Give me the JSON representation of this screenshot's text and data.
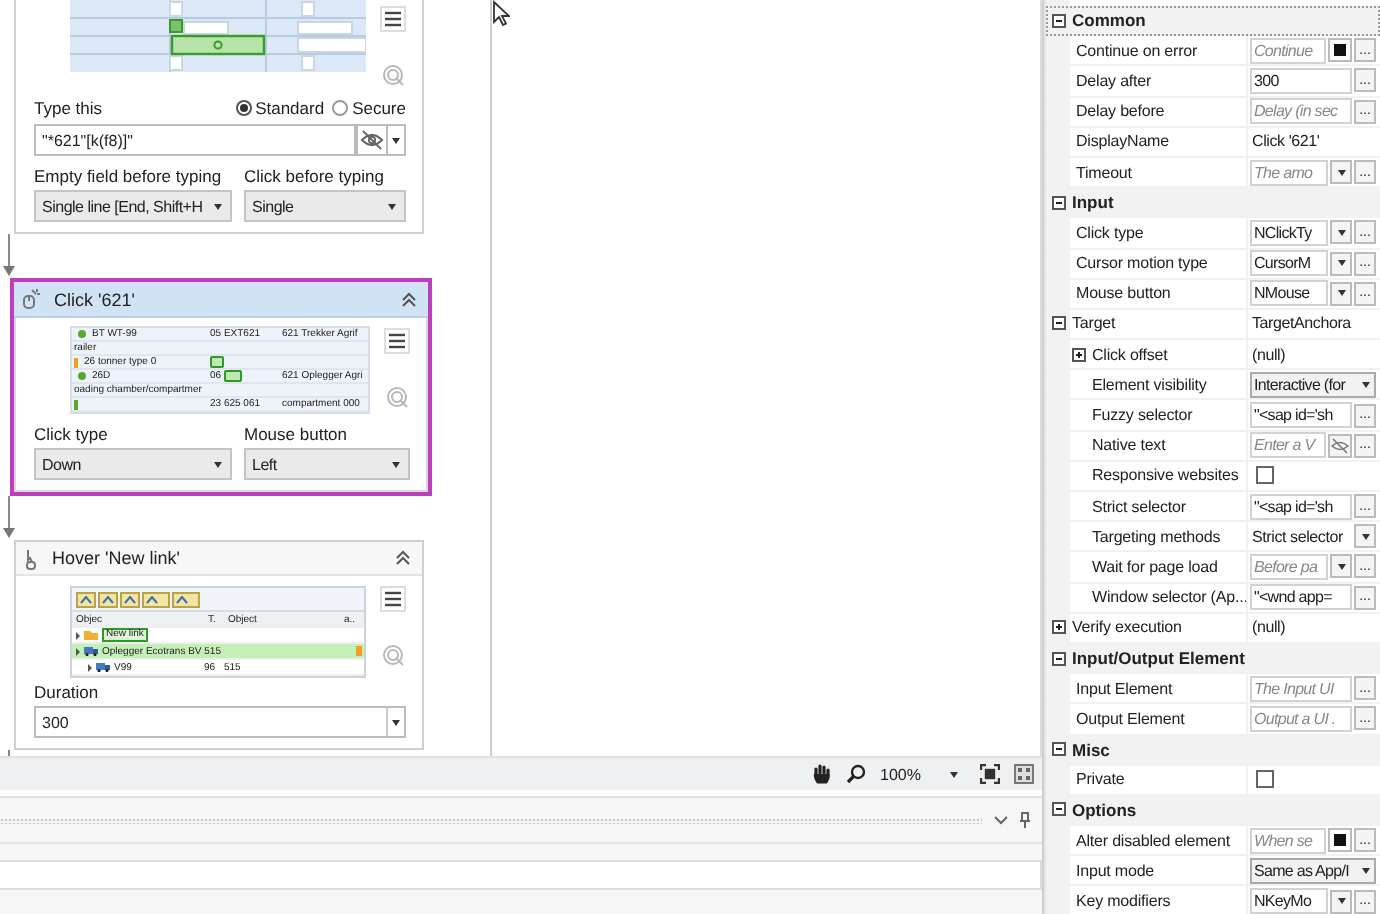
{
  "designer": {
    "activities": [
      {
        "kind": "type_into",
        "selected": false,
        "screenshot": {
          "kind": "form"
        },
        "text_field": {
          "label": "Type this",
          "value": "\"*621\"[k(f8)]\""
        },
        "modes": [
          {
            "label": "Standard",
            "selected": true
          },
          {
            "label": "Secure",
            "selected": false
          }
        ],
        "dropdowns": [
          {
            "label": "Empty field before typing",
            "value": "Single line [End, Shift+H"
          },
          {
            "label": "Click before typing",
            "value": "Single"
          }
        ]
      },
      {
        "kind": "click",
        "title": "Click '621'",
        "selected": true,
        "screenshot": {
          "kind": "table",
          "rows": [
            {
              "kind": "dot",
              "color": "#5aa832",
              "a": "BT WT-99",
              "b": "05  EXT621",
              "c": "621  Trekker Agrif"
            },
            {
              "kind": "plain",
              "a": "railer"
            },
            {
              "kind": "bar",
              "color": "#f0a020",
              "a": "26 tonner type 0",
              "anchor": true
            },
            {
              "kind": "dot",
              "color": "#5aa832",
              "a": "26D",
              "b": "06",
              "target": true,
              "c": "621  Oplegger Agri"
            },
            {
              "kind": "plain",
              "a": "oading chamber/compartmer"
            },
            {
              "kind": "bar",
              "color": "#5aa832",
              "b": "23  625 061",
              "c": "compartment 000"
            }
          ]
        },
        "dropdowns": [
          {
            "label": "Click type",
            "value": "Down"
          },
          {
            "label": "Mouse button",
            "value": "Left"
          }
        ]
      },
      {
        "kind": "hover",
        "title": "Hover 'New link'",
        "selected": false,
        "screenshot": {
          "kind": "tree",
          "columns": [
            "Objec",
            "T.",
            "Object",
            "a.."
          ],
          "rows": [
            {
              "kind": "folder",
              "label": "New link",
              "selected": false,
              "target": true
            },
            {
              "kind": "truck",
              "label": "Oplegger Ecotrans BV 515",
              "selected": true,
              "children": [
                {
                  "kind": "truck",
                  "label": "V99",
                  "selected": false,
                  "t": "96",
                  "object": "515"
                }
              ]
            }
          ]
        },
        "combo": {
          "label": "Duration",
          "value": "300"
        }
      }
    ]
  },
  "zoom": {
    "value": "100%"
  },
  "properties": [
    {
      "kind": "category",
      "label": "Common",
      "expanded": true,
      "focused": true,
      "children": [
        {
          "label": "Continue on error",
          "editor": {
            "kind": "field",
            "placeholder": "Continue",
            "buttons": [
              {
                "kind": "toggle"
              },
              {
                "kind": "more",
                "label": "..."
              }
            ]
          }
        },
        {
          "label": "Delay after",
          "editor": {
            "kind": "field",
            "value": "300",
            "buttons": [
              {
                "kind": "more",
                "label": "..."
              }
            ]
          }
        },
        {
          "label": "Delay before",
          "editor": {
            "kind": "field",
            "placeholder": "Delay (in sec",
            "buttons": [
              {
                "kind": "more",
                "label": "..."
              }
            ]
          }
        },
        {
          "label": "DisplayName",
          "editor": {
            "kind": "text",
            "value": "Click '621'"
          }
        },
        {
          "label": "Timeout",
          "editor": {
            "kind": "field",
            "placeholder": "The amo",
            "buttons": [
              {
                "kind": "dropdown"
              },
              {
                "kind": "more",
                "label": "..."
              }
            ]
          }
        }
      ]
    },
    {
      "kind": "category",
      "label": "Input",
      "expanded": true,
      "children": [
        {
          "label": "Click type",
          "editor": {
            "kind": "field",
            "value": "NClickTy",
            "buttons": [
              {
                "kind": "dropdown"
              },
              {
                "kind": "more",
                "label": "..."
              }
            ]
          }
        },
        {
          "label": "Cursor motion type",
          "editor": {
            "kind": "field",
            "value": "CursorM",
            "buttons": [
              {
                "kind": "dropdown"
              },
              {
                "kind": "more",
                "label": "..."
              }
            ]
          }
        },
        {
          "label": "Mouse button",
          "editor": {
            "kind": "field",
            "value": "NMouse",
            "buttons": [
              {
                "kind": "dropdown"
              },
              {
                "kind": "more",
                "label": "..."
              }
            ]
          }
        },
        {
          "label": "Target",
          "expanded": true,
          "editor": {
            "kind": "text",
            "value": "TargetAnchora"
          },
          "children": [
            {
              "label": "Click offset",
              "expanded": false,
              "editor": {
                "kind": "text",
                "value": "(null)"
              }
            },
            {
              "label": "Element visibility",
              "editor": {
                "kind": "combo",
                "value": "Interactive (for"
              }
            },
            {
              "label": "Fuzzy selector",
              "editor": {
                "kind": "field",
                "value": "\"<sap id='sh",
                "buttons": [
                  {
                    "kind": "more",
                    "label": "..."
                  }
                ]
              }
            },
            {
              "label": "Native text",
              "editor": {
                "kind": "field",
                "placeholder": "Enter a V",
                "buttons": [
                  {
                    "kind": "eye"
                  },
                  {
                    "kind": "more",
                    "label": "..."
                  }
                ]
              }
            },
            {
              "label": "Responsive websites",
              "editor": {
                "kind": "checkbox",
                "checked": false
              }
            },
            {
              "label": "Strict selector",
              "editor": {
                "kind": "field",
                "value": "\"<sap id='sh",
                "buttons": [
                  {
                    "kind": "more",
                    "label": "..."
                  }
                ]
              }
            },
            {
              "label": "Targeting methods",
              "editor": {
                "kind": "text",
                "value": "Strict selector",
                "buttons": [
                  {
                    "kind": "dropdown"
                  }
                ]
              }
            },
            {
              "label": "Wait for page load",
              "editor": {
                "kind": "field",
                "placeholder": "Before pa",
                "buttons": [
                  {
                    "kind": "dropdown"
                  },
                  {
                    "kind": "more",
                    "label": "..."
                  }
                ]
              }
            },
            {
              "label": "Window selector (Ap...",
              "editor": {
                "kind": "field",
                "value": "\"<wnd app=",
                "buttons": [
                  {
                    "kind": "more",
                    "label": "..."
                  }
                ]
              }
            }
          ]
        },
        {
          "label": "Verify execution",
          "expanded": false,
          "editor": {
            "kind": "text",
            "value": "(null)"
          }
        }
      ]
    },
    {
      "kind": "category",
      "label": "Input/Output Element",
      "expanded": true,
      "children": [
        {
          "label": "Input Element",
          "editor": {
            "kind": "field",
            "placeholder": "The Input UI",
            "buttons": [
              {
                "kind": "more",
                "label": "..."
              }
            ]
          }
        },
        {
          "label": "Output Element",
          "editor": {
            "kind": "field",
            "placeholder": "Output a UI .",
            "buttons": [
              {
                "kind": "more",
                "label": "..."
              }
            ]
          }
        }
      ]
    },
    {
      "kind": "category",
      "label": "Misc",
      "expanded": true,
      "children": [
        {
          "label": "Private",
          "editor": {
            "kind": "checkbox",
            "checked": false
          }
        }
      ]
    },
    {
      "kind": "category",
      "label": "Options",
      "expanded": true,
      "children": [
        {
          "label": "Alter disabled element",
          "editor": {
            "kind": "field",
            "placeholder": "When se",
            "buttons": [
              {
                "kind": "toggle"
              },
              {
                "kind": "more",
                "label": "..."
              }
            ]
          }
        },
        {
          "label": "Input mode",
          "editor": {
            "kind": "combo",
            "value": "Same as App/I"
          }
        },
        {
          "label": "Key modifiers",
          "editor": {
            "kind": "field",
            "value": "NKeyMo",
            "buttons": [
              {
                "kind": "dropdown"
              },
              {
                "kind": "more",
                "label": "..."
              }
            ]
          }
        }
      ]
    }
  ]
}
